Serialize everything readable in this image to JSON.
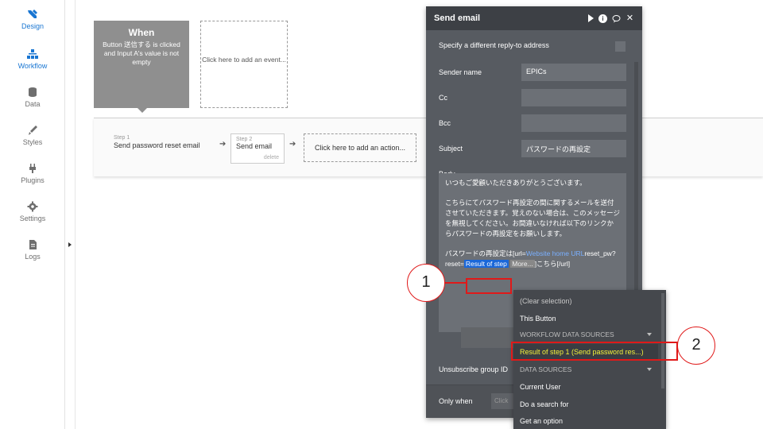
{
  "sidebar": {
    "items": [
      {
        "label": "Design",
        "icon": "design-icon"
      },
      {
        "label": "Workflow",
        "icon": "workflow-icon"
      },
      {
        "label": "Data",
        "icon": "data-icon"
      },
      {
        "label": "Styles",
        "icon": "styles-icon"
      },
      {
        "label": "Plugins",
        "icon": "plugins-icon"
      },
      {
        "label": "Settings",
        "icon": "settings-icon"
      },
      {
        "label": "Logs",
        "icon": "logs-icon"
      }
    ]
  },
  "event": {
    "title": "When",
    "description": "Button 送信する is clicked and Input A's value is not empty",
    "add_event": "Click here to add an event..."
  },
  "steps": {
    "step1_num": "Step 1",
    "step1_label": "Send password reset email",
    "step2_num": "Step 2",
    "step2_label": "Send email",
    "step2_delete": "delete",
    "add_action": "Click here to add an action..."
  },
  "panel": {
    "title": "Send email",
    "reply_to_label": "Specify a different reply-to address",
    "sender_name_label": "Sender name",
    "sender_name_value": "EPICs",
    "cc_label": "Cc",
    "bcc_label": "Bcc",
    "subject_label": "Subject",
    "subject_value": "パスワードの再設定",
    "body_label": "Body",
    "body_p1": "いつもご愛顧いただきありがとうございます。",
    "body_p2": "こちらにてパスワード再設定の間に関するメールを送付させていただきます。覚えのない場合は、このメッセージを無視してください。お間違いなければ以下のリンクからパスワードの再設定をお願いします。",
    "body_p3_prefix": "パスワードの再設定は[url=",
    "body_p3_link": "Website home URL",
    "body_p3_mid": "reset_pw?reset=",
    "body_p3_tag": "Result of step",
    "body_p3_more": "More...",
    "body_p3_suffix": "]こちら[/url]",
    "unsubscribe_label": "Unsubscribe group ID",
    "only_when_label": "Only when",
    "only_when_hint": "Click"
  },
  "dropdown": {
    "clear": "(Clear selection)",
    "this_button": "This Button",
    "workflow_sources": "WORKFLOW DATA SOURCES",
    "result_step1": "Result of step 1 (Send password res...)",
    "data_sources": "DATA SOURCES",
    "current_user": "Current User",
    "do_search": "Do a search for",
    "get_option": "Get an option"
  },
  "annotations": {
    "marker1": "1",
    "marker2": "2",
    "color": "#e01919"
  }
}
